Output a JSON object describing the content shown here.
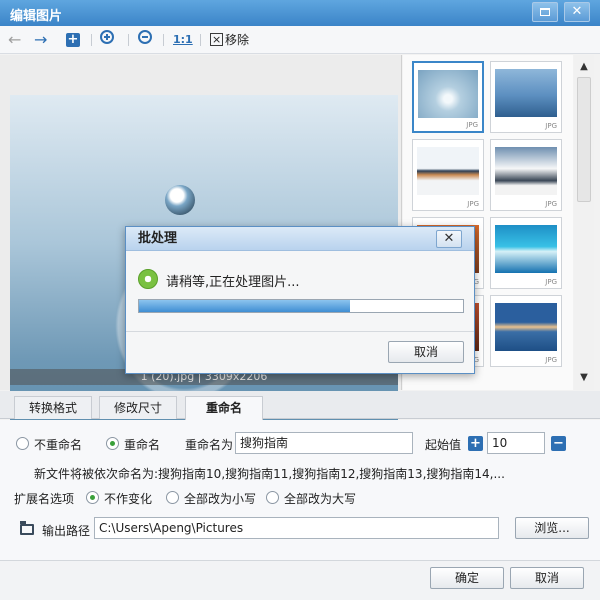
{
  "window": {
    "title": "编辑图片",
    "close_glyph": "✕"
  },
  "toolbar": {
    "back_glyph": "←",
    "forward_glyph": "→",
    "add_glyph": "+",
    "ratio_label": "1:1",
    "remove_label": "移除"
  },
  "preview": {
    "caption": "1 (20).jpg | 3309x2206"
  },
  "thumbnails": [
    {
      "ext": "JPG"
    },
    {
      "ext": "JPG"
    },
    {
      "ext": "JPG"
    },
    {
      "ext": "JPG"
    },
    {
      "ext": "JPG"
    },
    {
      "ext": "JPG"
    },
    {
      "ext": "JPG"
    },
    {
      "ext": "JPG"
    }
  ],
  "scrollbar": {
    "up_glyph": "▲",
    "down_glyph": "▼"
  },
  "dialog": {
    "title": "批处理",
    "close_glyph": "✕",
    "message": "请稍等,正在处理图片...",
    "progress": 0.65,
    "cancel_label": "取消"
  },
  "tabs": [
    {
      "label": "转换格式"
    },
    {
      "label": "修改尺寸"
    },
    {
      "label": "重命名"
    }
  ],
  "rename": {
    "no_rename_label": "不重命名",
    "rename_label": "重命名",
    "rename_as_label": "重命名为",
    "rename_as_value": "搜狗指南",
    "start_value_label": "起始值",
    "start_value": "10",
    "plus_glyph": "+",
    "minus_glyph": "−",
    "example_text": "新文件将被依次命名为:搜狗指南10,搜狗指南11,搜狗指南12,搜狗指南13,搜狗指南14,..."
  },
  "extension": {
    "label": "扩展名选项",
    "opt_none": "不作变化",
    "opt_lower": "全部改为小写",
    "opt_upper": "全部改为大写"
  },
  "output": {
    "label": "输出路径",
    "path": "C:\\Users\\Apeng\\Pictures",
    "browse_label": "浏览..."
  },
  "footer": {
    "ok_label": "确定",
    "cancel_label": "取消"
  }
}
